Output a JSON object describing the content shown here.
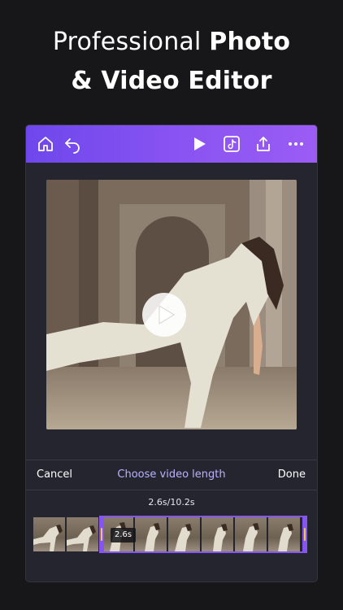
{
  "headline": {
    "line1_light": "Professional ",
    "line1_bold": "Photo",
    "line2_bold": "& Video Editor"
  },
  "toolbar": {
    "gradient_start": "#6e47ec",
    "gradient_end": "#9b5cf4",
    "icons": [
      "home-icon",
      "undo-icon",
      "play-icon",
      "tiktok-icon",
      "share-icon",
      "more-icon"
    ]
  },
  "action_bar": {
    "cancel_label": "Cancel",
    "title": "Choose video length",
    "done_label": "Done"
  },
  "timeline": {
    "duration_readout": "2.6s/10.2s",
    "selection_badge": "2.6s",
    "accent": "#8455f0",
    "handle_grip": "#f5c84c"
  }
}
